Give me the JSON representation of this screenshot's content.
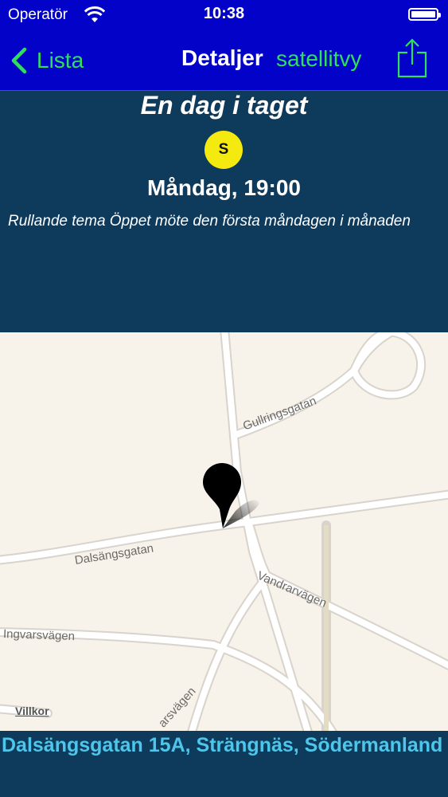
{
  "status_bar": {
    "carrier": "Operatör",
    "time": "10:38"
  },
  "nav": {
    "back_label": "Lista",
    "title": "Detaljer",
    "secondary": "satellitvy",
    "accent_color": "#2fe05a",
    "bar_color": "#0202c8"
  },
  "meeting": {
    "name": "En dag i taget",
    "badge": "S",
    "badge_color": "#f5ea10",
    "day_time": "Måndag, 19:00",
    "description": "Rullande tema Öppet möte den första måndagen i månaden"
  },
  "map": {
    "roads": {
      "gullringsgatan": "Gullringsgatan",
      "dalsangsgatan": "Dalsängsgatan",
      "vandrarvagen": "Vandrarvägen",
      "ingvarsvagen": "Ingvarsvägen",
      "partial": "arsvägen"
    },
    "legal": "Villkor",
    "pin_color": "#000000"
  },
  "address": "Dalsängsgatan 15A, Strängnäs, Södermanland"
}
